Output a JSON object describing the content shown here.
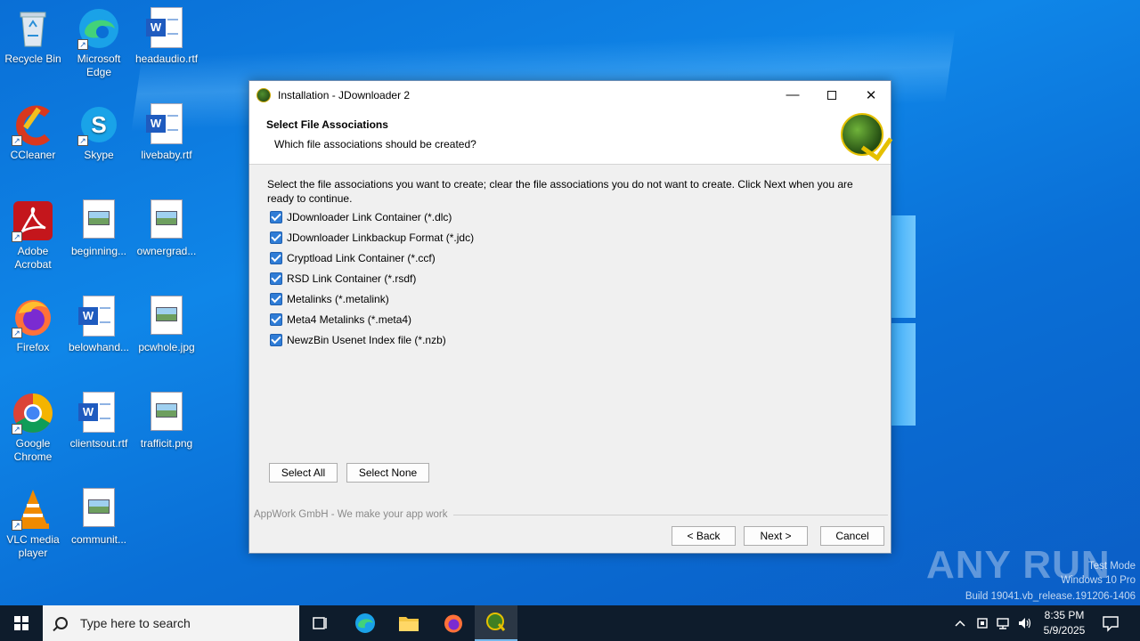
{
  "desktop": {
    "icons": [
      {
        "label": "Recycle Bin"
      },
      {
        "label": "Microsoft Edge"
      },
      {
        "label": "headaudio.rtf"
      },
      {
        "label": "CCleaner"
      },
      {
        "label": "Skype"
      },
      {
        "label": "livebaby.rtf"
      },
      {
        "label": "Adobe Acrobat"
      },
      {
        "label": "beginning..."
      },
      {
        "label": "ownergrad..."
      },
      {
        "label": "Firefox"
      },
      {
        "label": "belowhand..."
      },
      {
        "label": "pcwhole.jpg"
      },
      {
        "label": "Google Chrome"
      },
      {
        "label": "clientsout.rtf"
      },
      {
        "label": "trafficit.png"
      },
      {
        "label": "VLC media player"
      },
      {
        "label": "communit..."
      }
    ]
  },
  "dialog": {
    "window_title": "Installation - JDownloader 2",
    "header_title": "Select File Associations",
    "header_subtitle": "Which file associations should be created?",
    "intro": "Select the file associations you want to create; clear the file associations you do not want to create. Click Next when you are ready to continue.",
    "associations": [
      {
        "label": "JDownloader Link Container (*.dlc)",
        "checked": true
      },
      {
        "label": "JDownloader Linkbackup Format (*.jdc)",
        "checked": true
      },
      {
        "label": "Cryptload Link Container (*.ccf)",
        "checked": true
      },
      {
        "label": "RSD Link Container (*.rsdf)",
        "checked": true
      },
      {
        "label": "Metalinks (*.metalink)",
        "checked": true
      },
      {
        "label": "Meta4 Metalinks (*.meta4)",
        "checked": true
      },
      {
        "label": "NewzBin Usenet Index file (*.nzb)",
        "checked": true
      }
    ],
    "select_all": "Select All",
    "select_none": "Select None",
    "footer_brand": "AppWork GmbH - We make your app work",
    "back": "< Back",
    "next": "Next >",
    "cancel": "Cancel"
  },
  "watermark": {
    "mode": "Test Mode",
    "edition": "Windows 10 Pro",
    "build": "Build 19041.vb_release.191206-1406",
    "brand": "ANY RUN"
  },
  "taskbar": {
    "search_placeholder": "Type here to search",
    "time": "8:35 PM",
    "date": "5/9/2025"
  },
  "colors": {
    "desktop": "#0a6fd6",
    "taskbar": "#0e1c2c",
    "checkbox": "#2f7cd6"
  }
}
